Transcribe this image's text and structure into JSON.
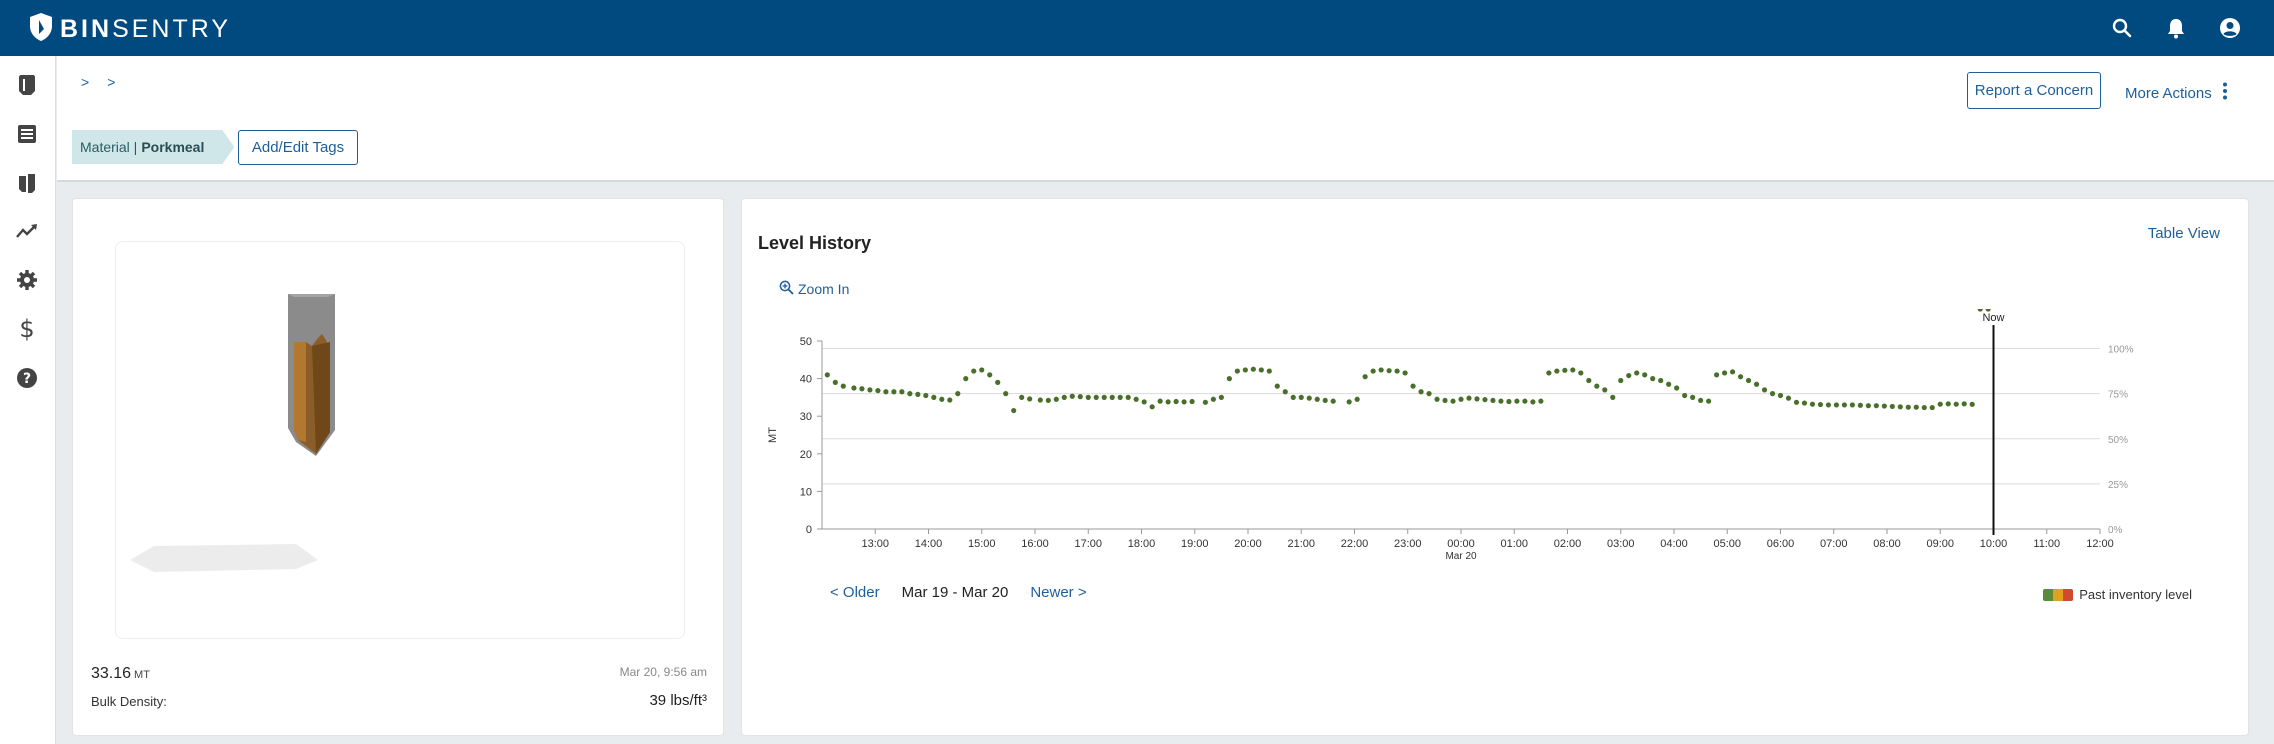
{
  "app": {
    "logo_bold": "BIN",
    "logo_light": "SENTRY"
  },
  "topbar": {
    "icons": [
      "search-icon",
      "bell-icon",
      "account-icon"
    ]
  },
  "sidebar": {
    "items": [
      "bin-icon",
      "list-icon",
      "bins-icon",
      "analytics-icon",
      "gear-icon",
      "dollar-icon",
      "help-icon"
    ]
  },
  "breadcrumb": {
    "sep1": ">",
    "sep2": ">"
  },
  "actions": {
    "report_label": "Report a Concern",
    "more_label": "More Actions"
  },
  "tags": {
    "material_label": "Material |",
    "material_value": "Porkmeal",
    "edit_tags_label": "Add/Edit Tags"
  },
  "bin_card": {
    "level_value": "33.16",
    "level_unit": "MT",
    "timestamp": "Mar 20, 9:56 am",
    "bulk_density_label": "Bulk Density:",
    "bulk_density_value": "39 lbs/ft³"
  },
  "history": {
    "title": "Level History",
    "table_view_label": "Table View",
    "zoom_in_label": "Zoom In",
    "older_label": "< Older",
    "range_label": "Mar 19 - Mar 20",
    "newer_label": "Newer >",
    "legend_label": "Past inventory level",
    "legend_colors": [
      "#5a8a3a",
      "#e0a020",
      "#d04a30"
    ]
  },
  "chart_data": {
    "type": "scatter",
    "ylabel": "MT",
    "ylim": [
      0,
      50
    ],
    "yticks": [
      0,
      10,
      20,
      30,
      40,
      50
    ],
    "y2ticks": [
      "0%",
      "25%",
      "50%",
      "75%",
      "100%"
    ],
    "xticks": [
      "13:00",
      "14:00",
      "15:00",
      "16:00",
      "17:00",
      "18:00",
      "19:00",
      "20:00",
      "21:00",
      "22:00",
      "23:00",
      "00:00",
      "01:00",
      "02:00",
      "03:00",
      "04:00",
      "05:00",
      "06:00",
      "07:00",
      "08:00",
      "09:00",
      "10:00",
      "11:00",
      "12:00"
    ],
    "date_marker": {
      "tick": "00:00",
      "label": "Mar 20"
    },
    "x_start_hour": 12.0,
    "x_end_hour": 36.0,
    "now_label": "Now",
    "now_hour": 34.0,
    "point_color": "#4a6f2a",
    "x": [
      12.1,
      12.25,
      12.4,
      12.6,
      12.75,
      12.9,
      13.05,
      13.2,
      13.35,
      13.5,
      13.65,
      13.8,
      13.95,
      14.1,
      14.25,
      14.4,
      14.55,
      14.7,
      14.85,
      15.0,
      15.15,
      15.3,
      15.45,
      15.6,
      15.75,
      15.9,
      16.1,
      16.25,
      16.4,
      16.55,
      16.7,
      16.85,
      17.0,
      17.15,
      17.3,
      17.45,
      17.6,
      17.75,
      17.9,
      18.05,
      18.2,
      18.35,
      18.5,
      18.65,
      18.8,
      18.95,
      19.2,
      19.35,
      19.5,
      19.65,
      19.8,
      19.95,
      20.1,
      20.25,
      20.4,
      20.55,
      20.7,
      20.85,
      21.0,
      21.15,
      21.3,
      21.45,
      21.6,
      21.9,
      22.05,
      22.2,
      22.35,
      22.5,
      22.65,
      22.8,
      22.95,
      23.1,
      23.25,
      23.4,
      23.55,
      23.7,
      23.85,
      24.0,
      24.15,
      24.3,
      24.45,
      24.6,
      24.75,
      24.9,
      25.05,
      25.2,
      25.35,
      25.5,
      25.65,
      25.8,
      25.95,
      26.1,
      26.25,
      26.4,
      26.55,
      26.7,
      26.85,
      27.0,
      27.15,
      27.3,
      27.45,
      27.6,
      27.75,
      27.9,
      28.05,
      28.2,
      28.35,
      28.5,
      28.65,
      28.8,
      28.95,
      29.1,
      29.25,
      29.4,
      29.55,
      29.7,
      29.85,
      30.0,
      30.15,
      30.3,
      30.45,
      30.6,
      30.75,
      30.9,
      31.05,
      31.2,
      31.35,
      31.5,
      31.65,
      31.8,
      31.95,
      32.1,
      32.25,
      32.4,
      32.55,
      32.7,
      32.85,
      33.0,
      33.15,
      33.3,
      33.45,
      33.6,
      33.75,
      33.9
    ],
    "y": [
      41,
      39,
      38,
      37.5,
      37.3,
      37,
      36.8,
      36.5,
      36.5,
      36.5,
      36,
      35.8,
      35.5,
      35,
      34.5,
      34.3,
      36,
      40,
      42,
      42.3,
      41,
      39,
      36,
      31.5,
      35,
      34.6,
      34.3,
      34.2,
      34.5,
      35,
      35.3,
      35.2,
      35,
      35,
      35,
      35,
      35,
      35,
      34.5,
      33.8,
      32.5,
      34,
      33.8,
      33.9,
      33.8,
      33.9,
      33.7,
      34.5,
      35,
      40,
      42,
      42.3,
      42.5,
      42.3,
      42,
      38,
      36.5,
      35,
      35,
      34.8,
      34.5,
      34.2,
      34,
      33.8,
      34.5,
      40.5,
      42,
      42.3,
      42.1,
      42,
      41.5,
      38,
      36.5,
      36,
      34.5,
      34.2,
      34,
      34.5,
      34.8,
      34.6,
      34.4,
      34.2,
      34,
      33.9,
      34,
      34,
      33.8,
      34,
      41.5,
      42,
      42.2,
      42.3,
      41.5,
      39.5,
      38,
      37,
      35,
      39.5,
      40.8,
      41.5,
      41,
      40,
      39.5,
      38.5,
      37.5,
      35.5,
      35,
      34.2,
      34,
      41,
      41.5,
      41.8,
      40.5,
      39.5,
      38.5,
      37,
      36,
      35.5,
      34.8,
      33.7,
      33.5,
      33.2,
      33.1,
      33,
      33,
      33,
      33,
      32.9,
      32.8,
      32.8,
      32.7,
      32.6,
      32.5,
      32.4,
      32.4,
      32.3,
      32.3,
      33.2,
      33.3,
      33.2,
      33.3,
      33.16
    ]
  }
}
